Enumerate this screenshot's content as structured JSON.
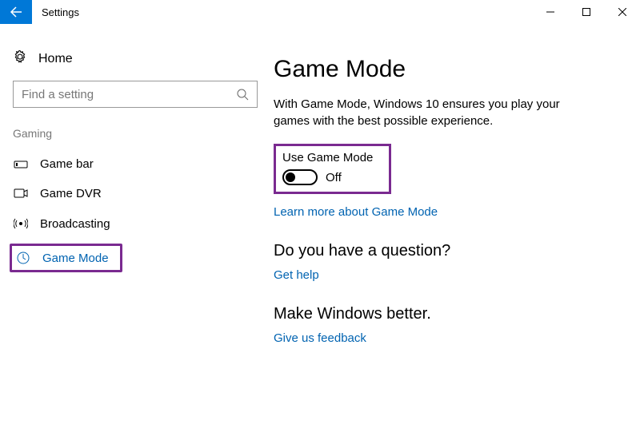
{
  "window": {
    "title": "Settings"
  },
  "sidebar": {
    "home": "Home",
    "search_placeholder": "Find a setting",
    "section": "Gaming",
    "items": [
      {
        "label": "Game bar"
      },
      {
        "label": "Game DVR"
      },
      {
        "label": "Broadcasting"
      },
      {
        "label": "Game Mode"
      }
    ]
  },
  "main": {
    "heading": "Game Mode",
    "description": "With Game Mode, Windows 10 ensures you play your games with the best possible experience.",
    "toggle_label": "Use Game Mode",
    "toggle_state": "Off",
    "learn_more": "Learn more about Game Mode",
    "question_heading": "Do you have a question?",
    "get_help": "Get help",
    "feedback_heading": "Make Windows better.",
    "feedback_link": "Give us feedback"
  }
}
